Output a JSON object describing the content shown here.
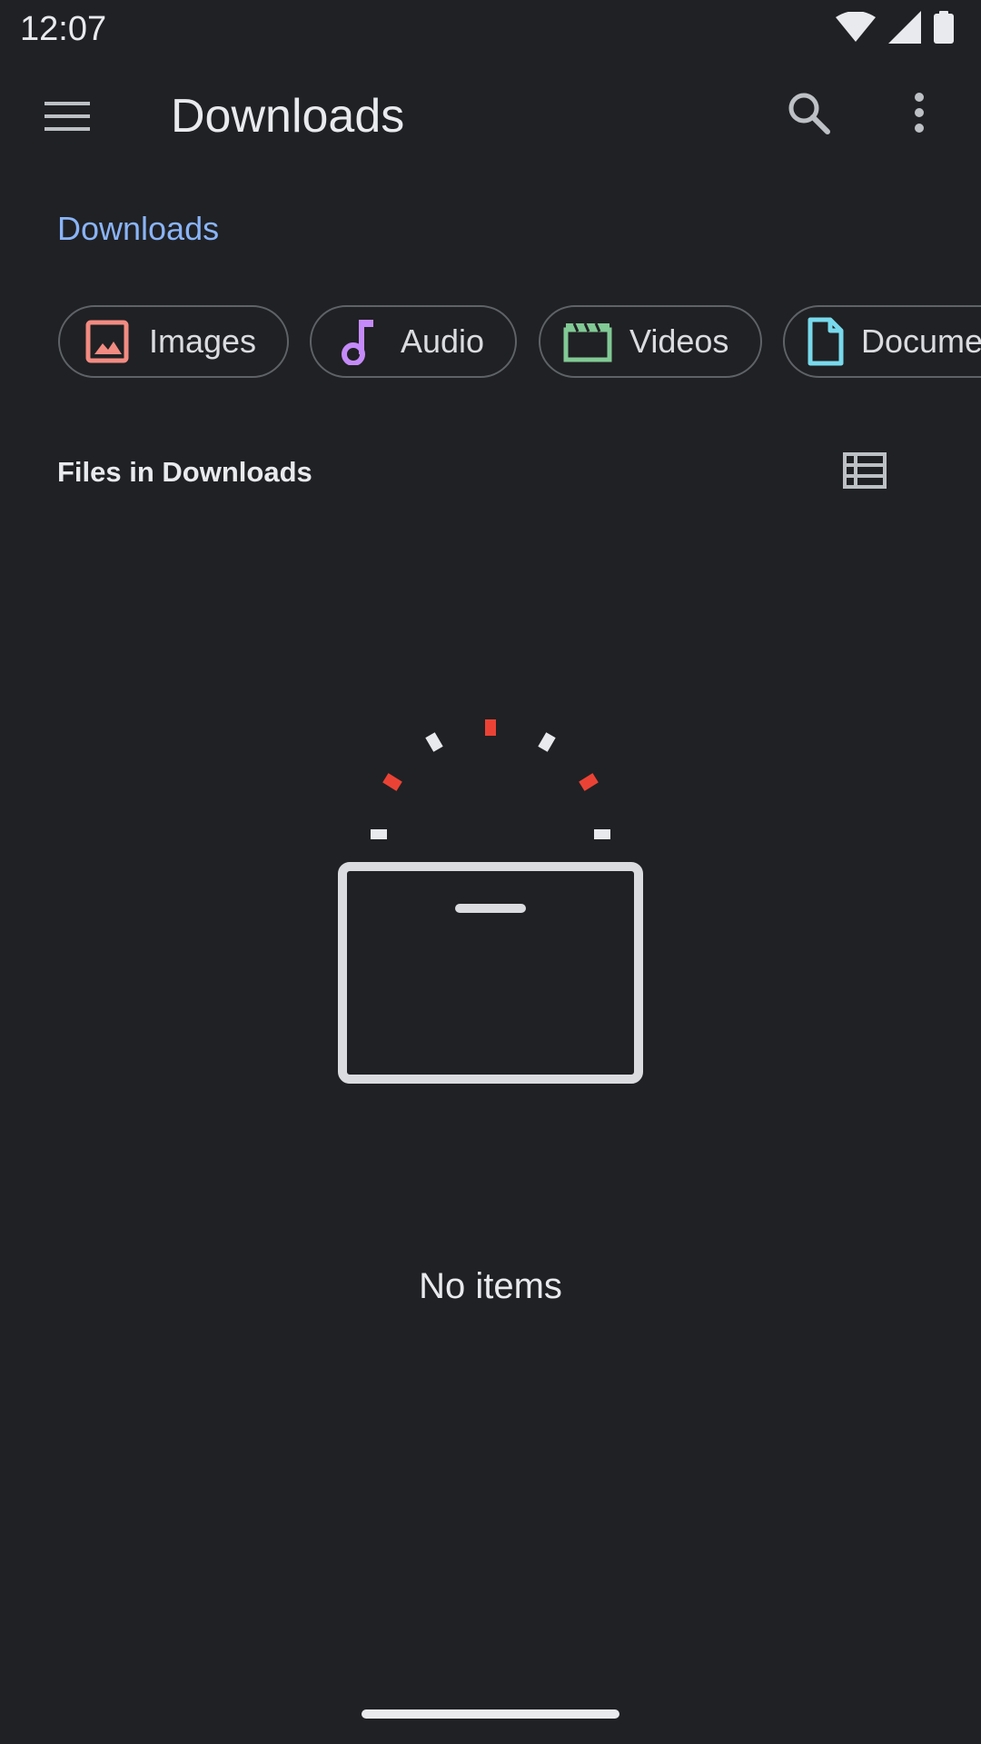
{
  "status_bar": {
    "time": "12:07",
    "icons": [
      "wifi-icon",
      "cellular-signal-icon",
      "battery-icon"
    ]
  },
  "app_bar": {
    "menu_icon": "hamburger-menu-icon",
    "title": "Downloads",
    "search_icon": "search-icon",
    "more_icon": "more-vert-icon"
  },
  "breadcrumb": {
    "label": "Downloads",
    "color": "#8ab4f8"
  },
  "chips": [
    {
      "label": "Images",
      "icon": "image-icon",
      "color": "#f28b82"
    },
    {
      "label": "Audio",
      "icon": "music-note-icon",
      "color": "#c58af9"
    },
    {
      "label": "Videos",
      "icon": "movie-icon",
      "color": "#81c995"
    },
    {
      "label": "Documents",
      "icon": "document-icon",
      "color": "#78d9ec"
    }
  ],
  "section": {
    "title": "Files in Downloads",
    "view_toggle_icon": "list-view-icon"
  },
  "empty_state": {
    "illustration": "empty-box-icon",
    "message": "No items"
  },
  "colors": {
    "background": "#202124",
    "accent": "#8ab4f8",
    "illustration_red": "#ea4335"
  }
}
